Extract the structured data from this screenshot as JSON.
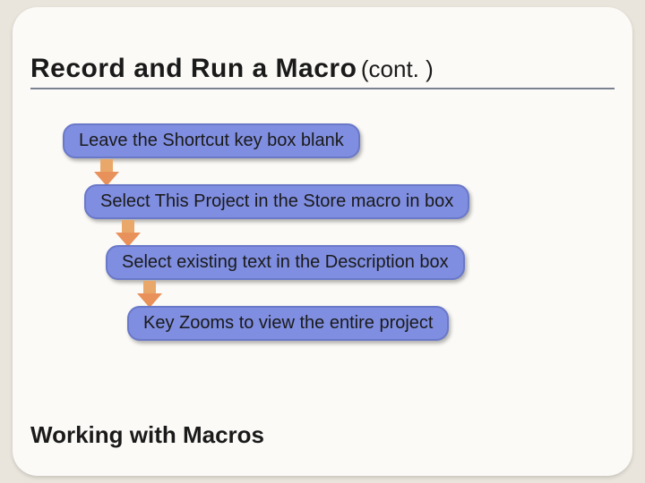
{
  "title": {
    "main": "Record and Run a Macro",
    "cont": "(cont. )"
  },
  "steps": [
    "Leave the Shortcut key box blank",
    "Select This Project in the Store macro in box",
    "Select existing text in the Description box",
    "Key Zooms to view the entire project"
  ],
  "footer": "Working with Macros"
}
